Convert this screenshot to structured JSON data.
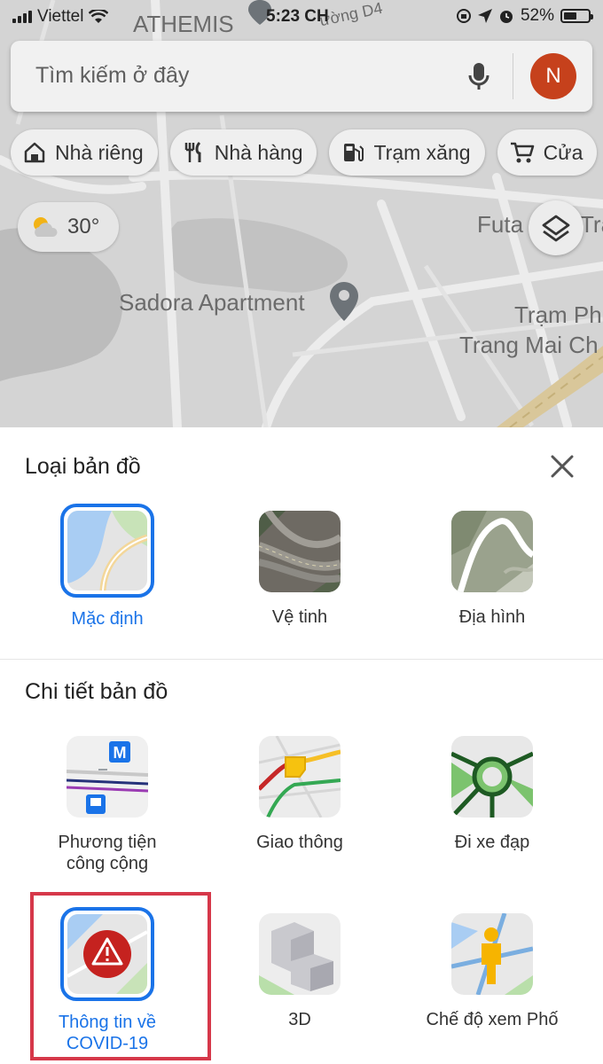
{
  "status_bar": {
    "carrier": "Viettel",
    "time": "5:23 CH",
    "battery": "52%"
  },
  "search": {
    "placeholder": "Tìm kiếm ở đây",
    "avatar_letter": "N"
  },
  "chips": [
    {
      "label": "Nhà riêng",
      "icon": "home-icon"
    },
    {
      "label": "Nhà hàng",
      "icon": "restaurant-icon"
    },
    {
      "label": "Trạm xăng",
      "icon": "gas-station-icon"
    },
    {
      "label": "Cửa",
      "icon": "cart-icon"
    }
  ],
  "weather": {
    "temp": "30°"
  },
  "map_labels": {
    "top_company": "ATHEMIS",
    "street": "ường D4",
    "futa": "Futa",
    "tra": "Tra",
    "sadora": "Sadora Apartment",
    "tram_ph": "Trạm Ph",
    "trang_mai": "Trang Mai Ch"
  },
  "sheet": {
    "map_type_title": "Loại bản đồ",
    "map_details_title": "Chi tiết bản đồ",
    "map_types": [
      {
        "label": "Mặc định",
        "selected": true
      },
      {
        "label": "Vệ tinh",
        "selected": false
      },
      {
        "label": "Địa hình",
        "selected": false
      }
    ],
    "details": [
      {
        "label_line1": "Phương tiện",
        "label_line2": "công cộng"
      },
      {
        "label_line1": "Giao thông",
        "label_line2": ""
      },
      {
        "label_line1": "Đi xe đạp",
        "label_line2": ""
      },
      {
        "label_line1": "Thông tin về",
        "label_line2": "COVID-19",
        "selected": true
      },
      {
        "label_line1": "3D",
        "label_line2": ""
      },
      {
        "label_line1": "Chế độ xem Phố",
        "label_line2": ""
      }
    ]
  },
  "colors": {
    "accent": "#1a73e8",
    "highlight": "#d6384a",
    "avatar": "#c6411c"
  }
}
